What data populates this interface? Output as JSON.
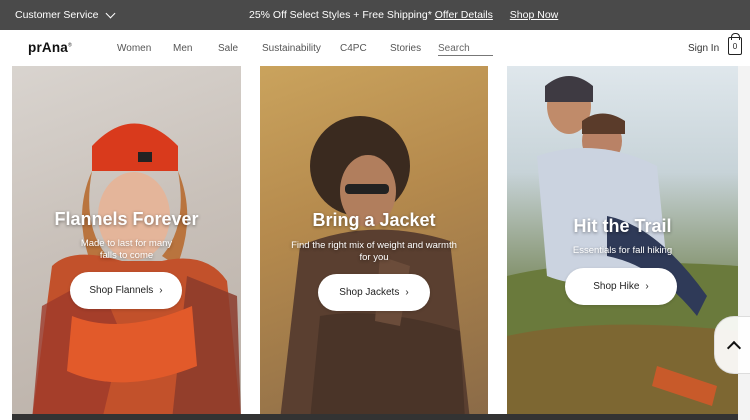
{
  "promo_bar": {
    "customer_service": "Customer Service",
    "message": "25% Off Select Styles + Free Shipping*",
    "offer_details": "Offer Details",
    "shop_now": "Shop Now"
  },
  "header": {
    "logo": "prAna",
    "nav": [
      "Women",
      "Men",
      "Sale",
      "Sustainability",
      "C4PC",
      "Stories"
    ],
    "search_placeholder": "Search",
    "sign_in": "Sign In",
    "bag_count": "0"
  },
  "panels": [
    {
      "title": "Flannels Forever",
      "subtitle_lines": [
        "Made to last for many",
        "falls to come"
      ],
      "button": "Shop Flannels"
    },
    {
      "title": "Bring a Jacket",
      "subtitle_lines": [
        "Find the right mix of weight and warmth",
        "for you"
      ],
      "button": "Shop Jackets"
    },
    {
      "title": "Hit the Trail",
      "subtitle_lines": [
        "Essentials for fall hiking"
      ],
      "button": "Shop Hike"
    }
  ],
  "colors": {
    "promo_bg": "#4a4a4a",
    "header_bg": "#ffffff",
    "button_bg": "#ffffff"
  },
  "icons": [
    "chevron-down-icon",
    "bag-icon",
    "arrow-right-icon",
    "chevron-up-icon"
  ]
}
